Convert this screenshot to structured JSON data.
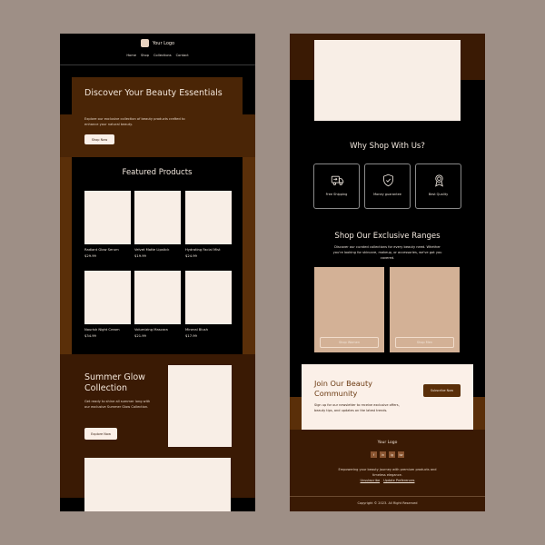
{
  "left_template": {
    "header": {
      "logo_text": "Your Logo",
      "nav": [
        "Home",
        "Shop",
        "Collections",
        "Contact"
      ]
    },
    "hero": {
      "title": "Discover Your Beauty Essentials",
      "description": "Explore our exclusive collection of beauty products crafted to enhance your natural beauty.",
      "button": "Shop Now"
    },
    "featured": {
      "title": "Featured Products",
      "products": [
        {
          "name": "Radiant Glow Serum",
          "price": "$29.99"
        },
        {
          "name": "Velvet Matte Lipstick",
          "price": "$19.99"
        },
        {
          "name": "Hydrating Facial Mist",
          "price": "$24.99"
        },
        {
          "name": "Nourish Night Cream",
          "price": "$34.99"
        },
        {
          "name": "Volumizing Mascara",
          "price": "$21.99"
        },
        {
          "name": "Mineral Blush",
          "price": "$17.99"
        }
      ]
    },
    "summer": {
      "title": "Summer Glow Collection",
      "description": "Get ready to shine all summer long with our exclusive Summer Glow Collection.",
      "button": "Explore Now"
    }
  },
  "right_template": {
    "why": {
      "title": "Why Shop With Us?",
      "features": [
        {
          "icon": "truck-icon",
          "label": "Free Shipping"
        },
        {
          "icon": "shield-check-icon",
          "label": "Money guarantee"
        },
        {
          "icon": "award-icon",
          "label": "Best Quality"
        }
      ]
    },
    "ranges": {
      "title": "Shop Our Exclusive Ranges",
      "description": "Discover our curated collections for every beauty need. Whether you're looking for skincare, makeup, or accessories, we've got you covered.",
      "buttons": [
        "Shop Women",
        "Shop Men"
      ]
    },
    "newsletter": {
      "title": "Join Our Beauty Community",
      "description": "Sign up for our newsletter to receive exclusive offers, beauty tips, and updates on the latest trends.",
      "button": "Subscribe Now"
    },
    "footer": {
      "logo_text": "Your Logo",
      "socials": [
        "f",
        "in",
        "ig",
        "tw"
      ],
      "description": "Empowering your beauty journey with premium products and timeless elegance.",
      "links": [
        "Unsubscribe",
        "Update Preferences"
      ],
      "copyright": "Copyright © 2023. All Right Reserved"
    }
  },
  "colors": {
    "background": "#9e8f86",
    "dark_brown": "#3a1a04",
    "brown": "#4a2506",
    "accent_brown": "#5a2f09",
    "cream": "#f8eee6",
    "tan": "#d3b196"
  }
}
